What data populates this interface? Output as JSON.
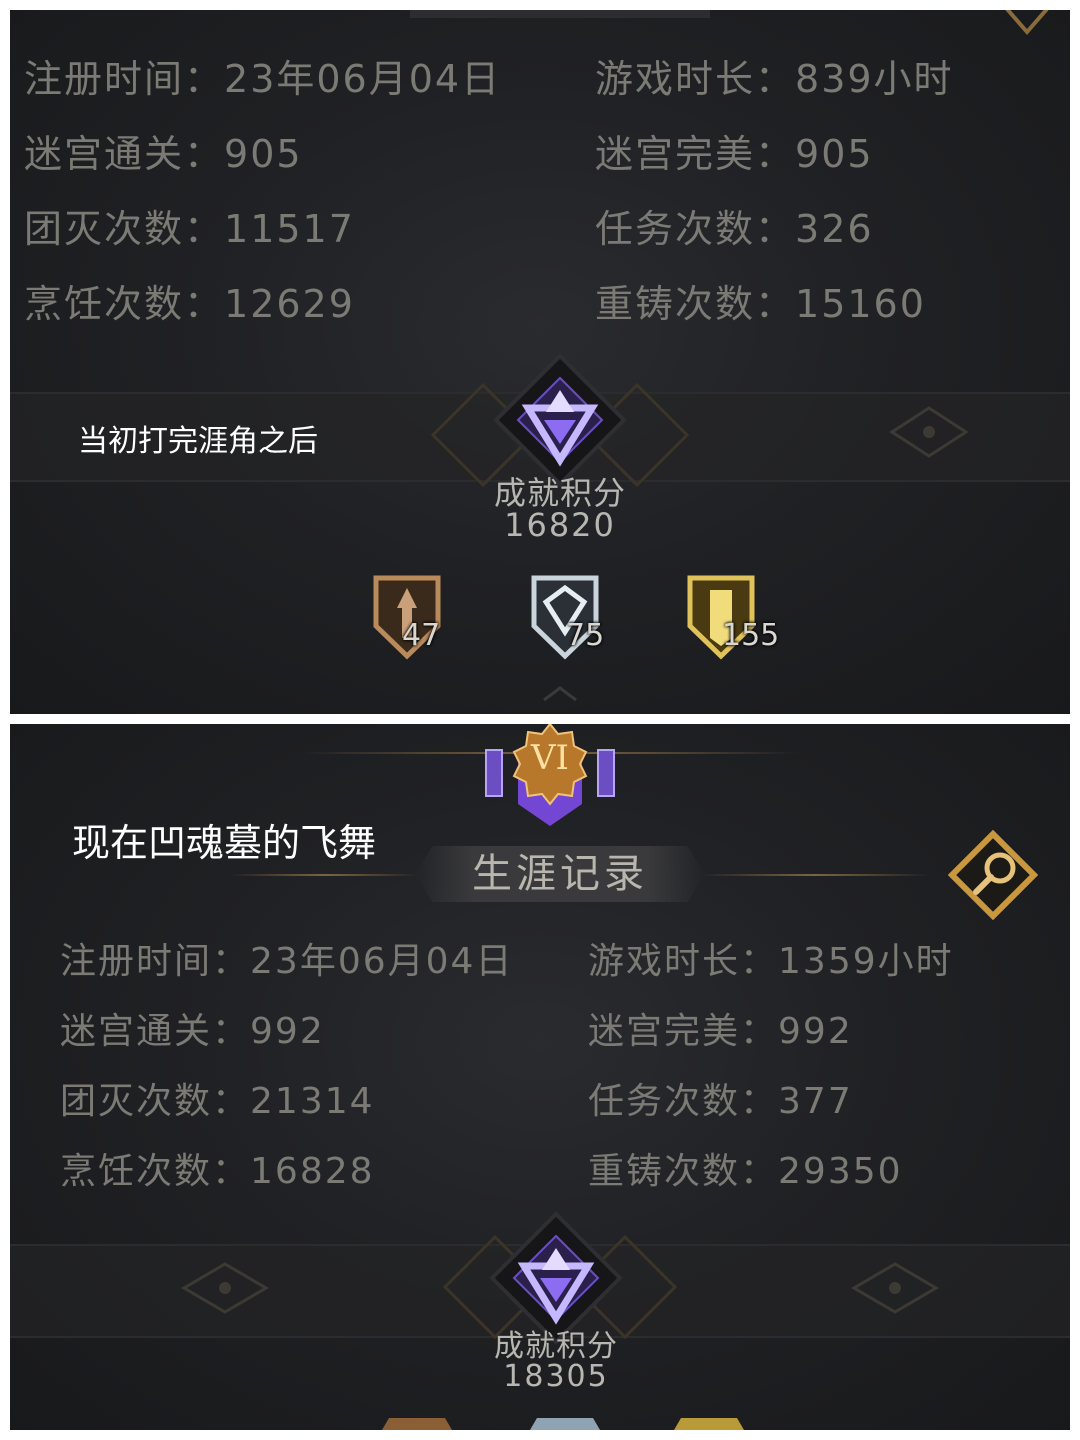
{
  "top_panel": {
    "stats": [
      {
        "label": "注册时间：",
        "value": "23年06月04日"
      },
      {
        "label": "游戏时长：",
        "value": "839小时"
      },
      {
        "label": "迷宫通关：",
        "value": "905"
      },
      {
        "label": "迷宫完美：",
        "value": "905"
      },
      {
        "label": "团灭次数：",
        "value": "11517"
      },
      {
        "label": "任务次数：",
        "value": "326"
      },
      {
        "label": "烹饪次数：",
        "value": "12629"
      },
      {
        "label": "重铸次数：",
        "value": "15160"
      }
    ],
    "caption": "当初打完涯角之后",
    "achievement": {
      "label": "成就积分",
      "value": "16820"
    },
    "badges": [
      {
        "icon": "bronze-shield-icon",
        "count": "47",
        "color": "#b98a5a"
      },
      {
        "icon": "silver-shield-icon",
        "count": "75",
        "color": "#c9d4dc"
      },
      {
        "icon": "gold-shield-icon",
        "count": "155",
        "color": "#e0c25a"
      }
    ]
  },
  "bottom_panel": {
    "rank_emblem": "VI",
    "caption": "现在凹魂墓的飞舞",
    "title": "生涯记录",
    "stats": [
      {
        "label": "注册时间：",
        "value": "23年06月04日"
      },
      {
        "label": "游戏时长：",
        "value": "1359小时"
      },
      {
        "label": "迷宫通关：",
        "value": "992"
      },
      {
        "label": "迷宫完美：",
        "value": "992"
      },
      {
        "label": "团灭次数：",
        "value": "21314"
      },
      {
        "label": "任务次数：",
        "value": "377"
      },
      {
        "label": "烹饪次数：",
        "value": "16828"
      },
      {
        "label": "重铸次数：",
        "value": "29350"
      }
    ],
    "achievement": {
      "label": "成就积分",
      "value": "18305"
    }
  },
  "colors": {
    "panel_bg": "#202124",
    "stat_text": "#7c7a74",
    "gold_accent": "#c8973e",
    "purple_accent": "#7b4fd6"
  }
}
